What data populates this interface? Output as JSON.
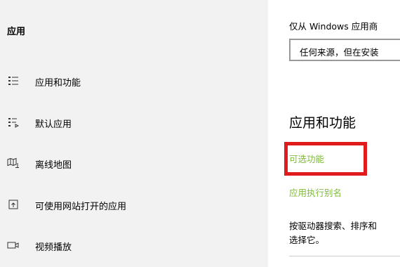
{
  "sidebar": {
    "title": "应用",
    "items": [
      {
        "label": "应用和功能",
        "icon": "apps-features-icon"
      },
      {
        "label": "默认应用",
        "icon": "default-apps-icon"
      },
      {
        "label": "离线地图",
        "icon": "offline-maps-icon"
      },
      {
        "label": "可使用网站打开的应用",
        "icon": "apps-for-websites-icon"
      },
      {
        "label": "视频播放",
        "icon": "video-playback-icon"
      }
    ]
  },
  "main": {
    "install_source_label": "仅从 Windows 应用商",
    "install_source_value": "任何来源，但在安装",
    "section_heading": "应用和功能",
    "optional_features_link": "可选功能",
    "app_alias_link": "应用执行别名",
    "description_line1": "按驱动器搜索、排序和",
    "description_line2": "选择它。"
  },
  "colors": {
    "sidebar_bg": "#f2f2f2",
    "link": "#7fba3a",
    "highlight": "#e01b1b"
  }
}
